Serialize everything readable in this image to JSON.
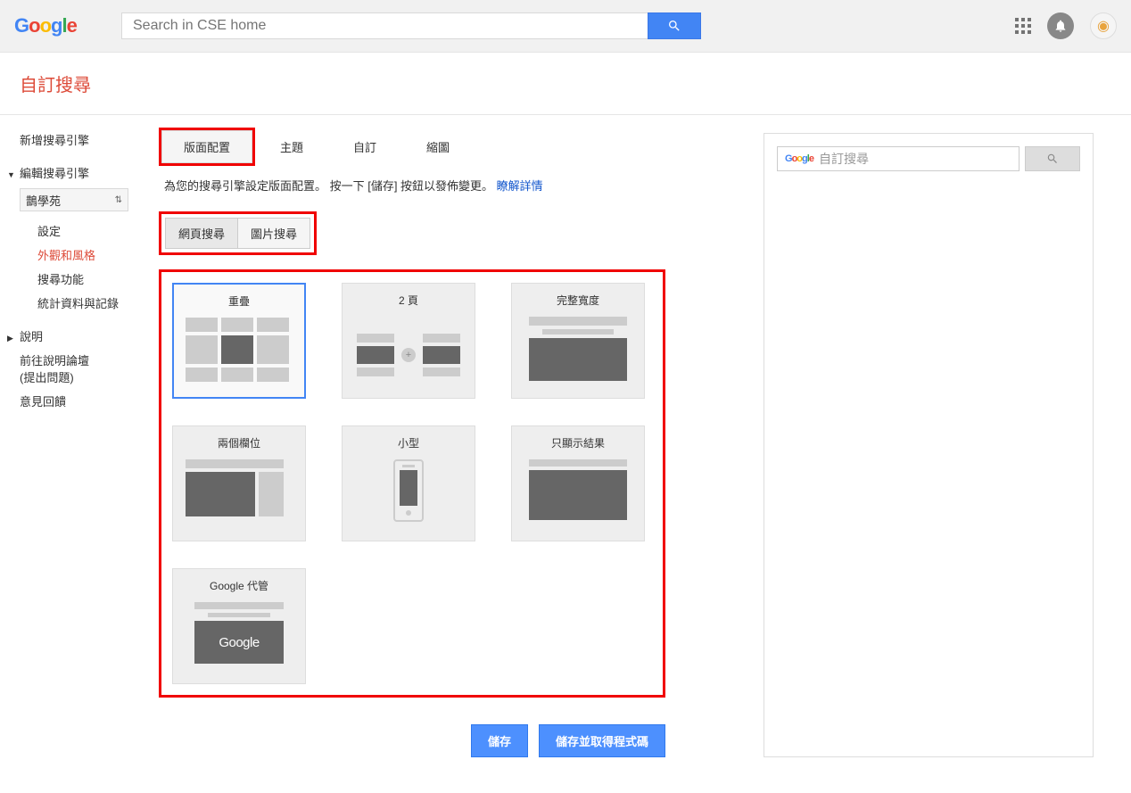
{
  "header": {
    "search_placeholder": "Search in CSE home"
  },
  "page_title": "自訂搜尋",
  "sidebar": {
    "new_engine": "新增搜尋引擎",
    "edit_engine": "編輯搜尋引擎",
    "engine_selected": "鵲學苑",
    "items": {
      "settings": "設定",
      "look_feel": "外觀和風格",
      "features": "搜尋功能",
      "stats": "統計資料與記錄"
    },
    "help": "說明",
    "forum_line1": "前往說明論壇",
    "forum_line2": "(提出問題)",
    "feedback": "意見回饋"
  },
  "tabs": {
    "layout": "版面配置",
    "theme": "主題",
    "custom": "自訂",
    "thumb": "縮圖"
  },
  "description": {
    "text": "為您的搜尋引擎設定版面配置。 按一下 [儲存] 按鈕以發佈變更。 ",
    "link": "瞭解詳情"
  },
  "sub_tabs": {
    "web": "網頁搜尋",
    "image": "圖片搜尋"
  },
  "layouts": {
    "overlay": "重疊",
    "two_page": "2 頁",
    "full_width": "完整寬度",
    "two_column": "兩個欄位",
    "compact": "小型",
    "results_only": "只顯示結果",
    "google_hosted": "Google 代管",
    "google_text": "Google"
  },
  "buttons": {
    "save": "儲存",
    "save_get_code": "儲存並取得程式碼"
  },
  "preview": {
    "cse_placeholder": "自訂搜尋"
  }
}
